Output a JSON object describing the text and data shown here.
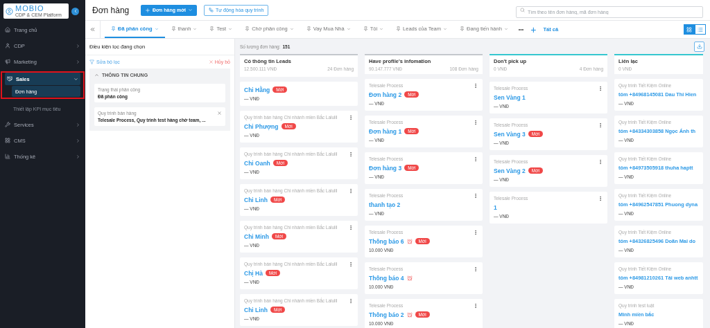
{
  "logo": {
    "name": "MOBIO",
    "tagline": "CDP & CEM Platform"
  },
  "sidebar": {
    "items": [
      {
        "label": "Trang chủ",
        "selected": false
      },
      {
        "label": "CDP",
        "selected": false
      },
      {
        "label": "Marketing",
        "selected": false
      },
      {
        "label": "Sales",
        "selected": true,
        "expanded": true,
        "children": [
          {
            "label": "Đơn hàng",
            "selected": true
          },
          {
            "label": "Thiết lập KPI mục tiêu",
            "selected": false
          }
        ]
      },
      {
        "label": "Services",
        "selected": false
      },
      {
        "label": "CMS",
        "selected": false
      },
      {
        "label": "Thống kê",
        "selected": false
      }
    ]
  },
  "header": {
    "title": "Đơn hàng",
    "new_button": "Đơn hàng mới",
    "automation_button": "Tự động hóa quy trình",
    "search": {
      "placeholder": "Tìm theo tên đơn hàng, mã đơn hàng"
    }
  },
  "tabs": [
    {
      "label": "Đã phân công",
      "selected": true
    },
    {
      "label": "thanh",
      "selected": false
    },
    {
      "label": "Test",
      "selected": false
    },
    {
      "label": "Chờ phân công",
      "selected": false
    },
    {
      "label": "Vay Mua Nhà",
      "selected": false
    },
    {
      "label": "Tôi",
      "selected": false
    },
    {
      "label": "Leads của Team",
      "selected": false
    },
    {
      "label": "Đang tiến hành",
      "selected": false
    }
  ],
  "more_tabs": "•••",
  "add_tab": "+",
  "all_tabs": "Tất cả",
  "view_modes": [
    {
      "kind": "grid",
      "selected": true
    },
    {
      "kind": "list",
      "selected": false
    }
  ],
  "filter_panel": {
    "title": "Điều kiện lọc đang chọn",
    "edit": "Sửa bộ lọc",
    "cancel": "Hủy bỏ",
    "section": {
      "title": "THÔNG TIN CHUNG",
      "expanded": true,
      "filters": [
        {
          "label": "Trạng thái phân công",
          "value": "Đã phân công",
          "removable": false
        },
        {
          "label": "Quy trình bán hàng",
          "value": "Telesale Process, Quy trình test hàng chờ team, ...",
          "removable": true
        }
      ]
    }
  },
  "board": {
    "count_label": "Số lượng đơn hàng:",
    "count": "151",
    "columns": [
      {
        "title": "Có thông tin Leads",
        "amount": "12.500.111 VNĐ",
        "orders": "24 Đơn hàng",
        "color": "#c4c7cc",
        "cards": [
          {
            "title": "Chi Hằng",
            "badge": "Mới",
            "alert": false,
            "amount": "— VNĐ"
          },
          {
            "process": "Quy trình bán hàng Chi nhánh miền Bắc Lalulil",
            "title": "Chi Phượng",
            "badge": "Mới",
            "alert": false,
            "amount": "— VNĐ"
          },
          {
            "process": "Quy trình bán hàng Chi nhánh miền Bắc Lalulil",
            "title": "Chi Oanh",
            "badge": "Mới",
            "alert": false,
            "amount": "— VNĐ"
          },
          {
            "process": "Quy trình bán hàng Chi nhánh miền Bắc Lalulil",
            "title": "Chi Linh",
            "badge": "Mới",
            "alert": false,
            "amount": "— VNĐ"
          },
          {
            "process": "Quy trình bán hàng Chi nhánh miền Bắc Lalulil",
            "title": "Chi Minh",
            "badge": "Mới",
            "alert": false,
            "amount": "— VNĐ"
          },
          {
            "process": "Quy trình bán hàng Chi nhánh miền Bắc Lalulil",
            "title": "Chị Hà",
            "badge": "Mới",
            "alert": false,
            "amount": "— VNĐ"
          },
          {
            "process": "Quy trình bán hàng Chi nhánh miền Bắc Lalulil",
            "title": "Chi Linh",
            "badge": "Mới",
            "alert": false,
            "amount": "— VNĐ"
          }
        ]
      },
      {
        "title": "Have profile's infomation",
        "amount": "90.147.777 VNĐ",
        "orders": "108 Đơn hàng",
        "color": "#c4c7cc",
        "cards": [
          {
            "process": "Telesale Process",
            "title": "Đơn hàng 2",
            "badge": "Mới",
            "alert": false,
            "amount": "— VNĐ"
          },
          {
            "process": "Telesale Process",
            "title": "Đơn hàng 1",
            "badge": "Mới",
            "alert": false,
            "amount": "— VNĐ"
          },
          {
            "process": "Telesale Process",
            "title": "Đơn hàng 3",
            "badge": "Mới",
            "alert": false,
            "amount": "— VNĐ"
          },
          {
            "process": "Telesale Process",
            "title": "thanh tạo 2",
            "alert": false,
            "amount": "— VNĐ"
          },
          {
            "process": "Telesale Process",
            "title": "Thông báo 6",
            "badge": "Mới",
            "alert": true,
            "amount": "10.000 VNĐ"
          },
          {
            "process": "Telesale Process",
            "title": "Thông báo 4",
            "alert": true,
            "amount": "10.000 VNĐ"
          },
          {
            "process": "Telesale Process",
            "title": "Thông báo 2",
            "badge": "Mới",
            "alert": true,
            "amount": "10.000 VNĐ"
          }
        ]
      },
      {
        "title": "Don't pick up",
        "amount": "0 VNĐ",
        "orders": "4 Đơn hàng",
        "color": "#35c6cf",
        "cards": [
          {
            "process": "Telesale Process",
            "title": "Sen Vàng 1",
            "alert": false,
            "amount": "— VNĐ"
          },
          {
            "process": "Telesale Process",
            "title": "Sen Vàng 3",
            "badge": "Mới",
            "alert": false,
            "amount": "— VNĐ"
          },
          {
            "process": "Telesale Process",
            "title": "Sen Vàng 2",
            "badge": "Mới",
            "alert": false,
            "amount": "— VNĐ"
          },
          {
            "process": "Telesale Process",
            "title": "1",
            "alert": false,
            "amount": "— VNĐ"
          }
        ]
      },
      {
        "title": "Liên lạc",
        "amount": "0 VNĐ",
        "color": "#35c6cf",
        "cards": [
          {
            "process": "Quy trình Tiết Kiệm Online",
            "title": "tôm +84968145081 Dau Thi Hien",
            "alert": false,
            "amount": "— VNĐ"
          },
          {
            "process": "Quy trình Tiết Kiệm Online",
            "title": "tôm +84334303858 Ngọc Ánh th",
            "alert": false,
            "amount": "— VNĐ"
          },
          {
            "process": "Quy trình Tiết Kiệm Online",
            "title": "tôm +84973505918 thuha haptt",
            "alert": false,
            "amount": "— VNĐ"
          },
          {
            "process": "Quy trình Tiết Kiệm Online",
            "title": "tôm +84962547851 Phuong dyna",
            "alert": false,
            "amount": "— VNĐ"
          },
          {
            "process": "Quy trình Tiết Kiệm Online",
            "title": "tôm +84326825496 Doãn Mai do",
            "alert": false,
            "amount": "— VNĐ"
          },
          {
            "process": "Quy trình Tiết Kiệm Online",
            "title": "tôm +84981210261 Tải web anhtt",
            "alert": false,
            "amount": "— VNĐ"
          },
          {
            "process": "Quy trình test luật",
            "title": "Minh miền bắc",
            "alert": false,
            "amount": "— VNĐ"
          }
        ]
      }
    ]
  }
}
